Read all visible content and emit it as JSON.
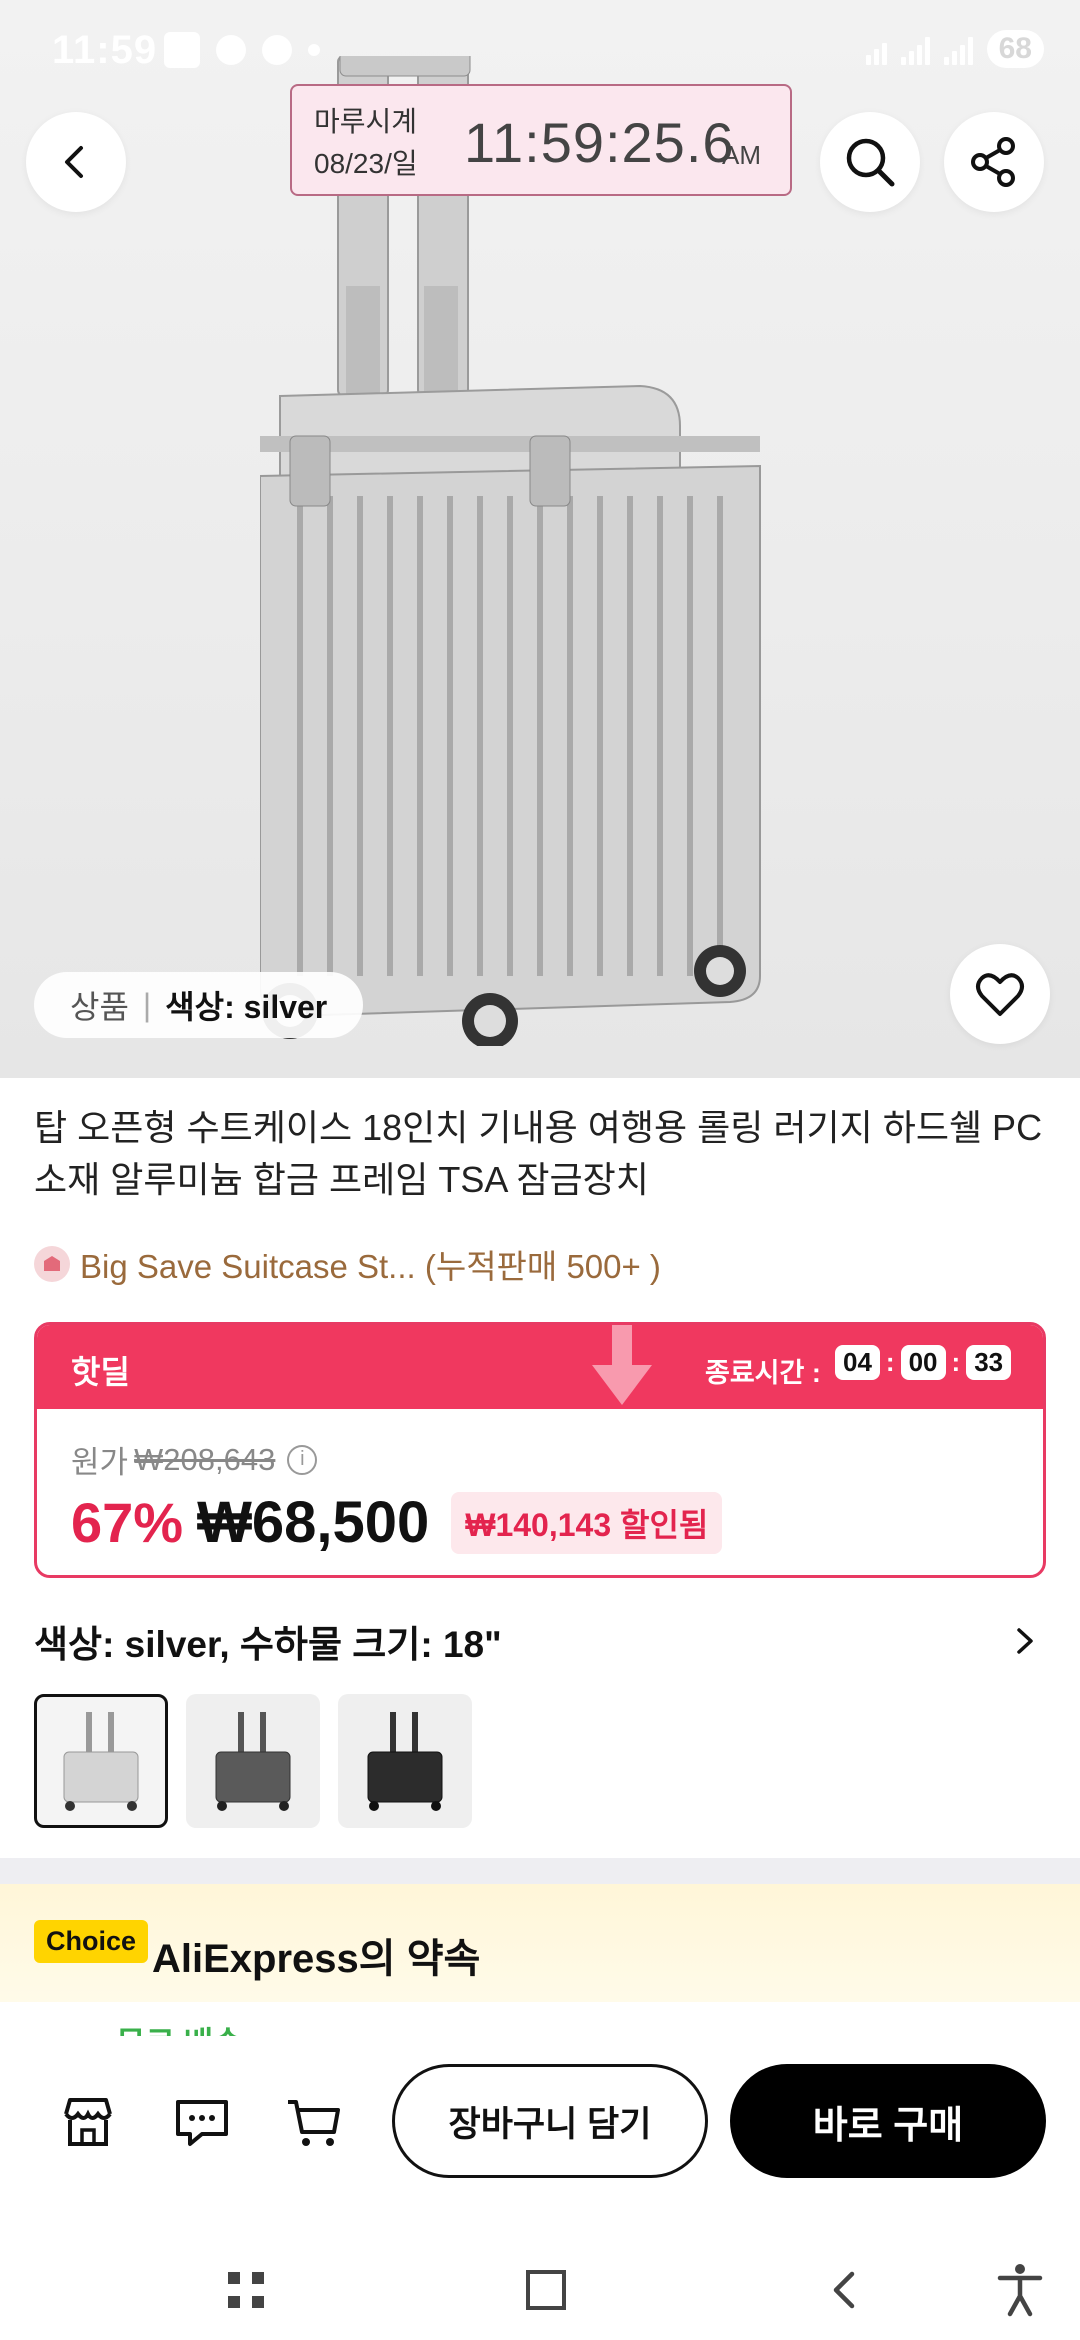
{
  "status_bar": {
    "time": "11:59",
    "battery": "68"
  },
  "clock_overlay": {
    "brand": "마루시계",
    "date": "08/23/일",
    "time": "11:59:25.6",
    "ampm": "AM"
  },
  "icons": {
    "back": "chevron-left-icon",
    "search": "search-icon",
    "share": "share-icon",
    "wishlist": "heart-icon",
    "store": "store-icon",
    "chat": "chat-icon",
    "cart": "cart-icon"
  },
  "image_chip": {
    "product_label": "상품",
    "selected_label": "색상: silver"
  },
  "product": {
    "title": "탑 오픈형 수트케이스 18인치 기내용 여행용 롤링 러기지 하드쉘 PC 소재 알루미늄 합금 프레임 TSA 잠금장치",
    "store_text": "Big Save Suitcase St... (누적판매 500+ )"
  },
  "hot_deal": {
    "label": "핫딜",
    "ends_label": "종료시간 :",
    "countdown": {
      "hh": "04",
      "mm": "00",
      "ss": "33"
    },
    "original_label": "원가",
    "original_price": "₩208,643",
    "discount_percent": "67%",
    "price": "₩68,500",
    "saved_text": "₩140,143 할인됨"
  },
  "variant": {
    "summary": "색상: silver, 수하물 크기: 18\"",
    "options": [
      "silver",
      "gray",
      "black"
    ],
    "selected_index": 0
  },
  "choice_banner": {
    "tag": "Choice",
    "text": "AliExpress의 약속"
  },
  "next_row_peek": "무료 배송",
  "bottom_bar": {
    "add_to_cart": "장바구니 담기",
    "buy_now": "바로 구매"
  },
  "colors": {
    "accent_red": "#f0385f",
    "price_red": "#e3244e",
    "store_brown": "#9a6a3c",
    "choice_yellow": "#ffd400"
  }
}
